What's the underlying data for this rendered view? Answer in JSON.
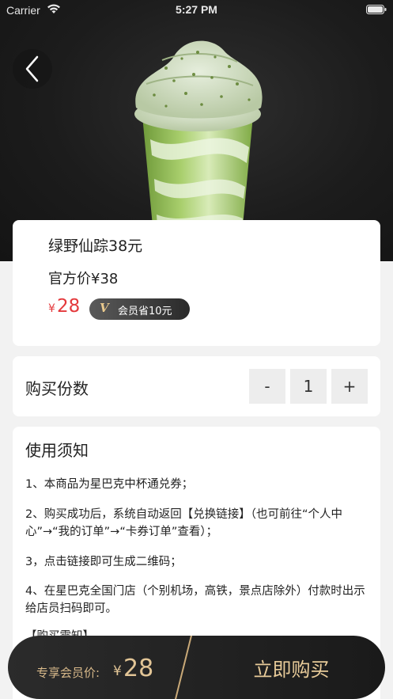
{
  "status_bar": {
    "carrier": "Carrier",
    "time": "5:27 PM"
  },
  "product": {
    "name": "绿野仙踪38元",
    "official_price": "官方价¥38",
    "price_currency": "¥",
    "price_value": "28",
    "member_badge": "会员省10元",
    "member_badge_icon": "V"
  },
  "quantity": {
    "label": "购买份数",
    "minus": "-",
    "value": "1",
    "plus": "+"
  },
  "notice": {
    "title": "使用须知",
    "items": [
      "1、本商品为星巴克中杯通兑券；",
      "2、购买成功后，系统自动返回【兑换链接】（也可前往“个人中心”→“我的订单”→“卡券订单”查看）；",
      "3，点击链接即可生成二维码；",
      "4、在星巴克全国门店（个别机场，高铁，景点店除外）付款时出示给店员扫码即可。",
      "【购买需知】"
    ]
  },
  "buy_bar": {
    "member_price_label": "专享会员价:",
    "member_price_currency": "¥",
    "member_price_value": "28",
    "buy_button": "立即购买"
  },
  "colors": {
    "price_red": "#e4393c",
    "gold": "#e2c596",
    "dark": "#1a1a1a"
  }
}
